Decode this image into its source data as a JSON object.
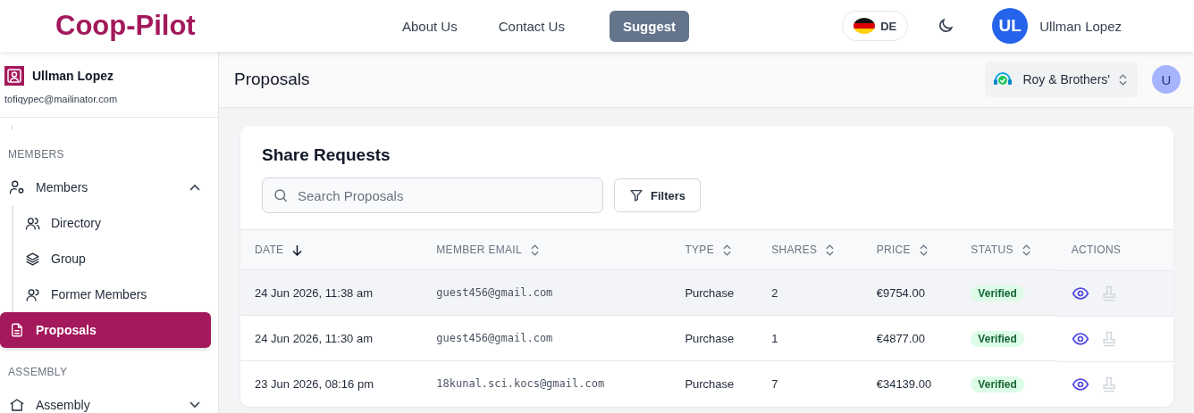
{
  "header": {
    "logo": "Coop-Pilot",
    "nav": [
      {
        "label": "About Us",
        "kind": "link"
      },
      {
        "label": "Contact Us",
        "kind": "link"
      },
      {
        "label": "Suggest",
        "kind": "button"
      }
    ],
    "language": "DE",
    "user": {
      "initials": "UL",
      "name": "Ullman Lopez"
    }
  },
  "sidebar": {
    "user": {
      "name": "Ullman Lopez",
      "email": "tofiqypec@mailinator.com"
    },
    "sections": [
      {
        "title": "MEMBERS",
        "items": [
          {
            "label": "Members",
            "selected": false,
            "expanded": true,
            "children": [
              {
                "label": "Directory",
                "selected": false
              },
              {
                "label": "Group",
                "selected": false
              },
              {
                "label": "Former Members",
                "selected": false
              }
            ]
          },
          {
            "label": "Proposals",
            "selected": true
          }
        ]
      },
      {
        "title": "ASSEMBLY",
        "items": [
          {
            "label": "Assembly",
            "selected": false,
            "expanded": false
          }
        ]
      }
    ]
  },
  "page": {
    "title": "Proposals",
    "organization": "Roy & Brothers'",
    "avatar": "U"
  },
  "card": {
    "title": "Share Requests",
    "search": {
      "placeholder": "Search Proposals"
    },
    "filters_button": "Filters",
    "table": {
      "columns": [
        {
          "label": "DATE",
          "kind": "sorted"
        },
        {
          "label": "MEMBER EMAIL",
          "kind": "sortable"
        },
        {
          "label": "TYPE",
          "kind": "sortable"
        },
        {
          "label": "SHARES",
          "kind": "sortable"
        },
        {
          "label": "PRICE",
          "kind": "sortable"
        },
        {
          "label": "STATUS",
          "kind": "sortable"
        },
        {
          "label": "ACTIONS",
          "kind": "plain"
        }
      ],
      "rows": [
        {
          "date": "24 Jun 2026, 11:38 am",
          "email": "guest456@gmail.com",
          "type": "Purchase",
          "shares": "2",
          "price": "€9754.00",
          "status": "Verified",
          "color": "#166534",
          "selected": true
        },
        {
          "date": "24 Jun 2026, 11:30 am",
          "email": "guest456@gmail.com",
          "type": "Purchase",
          "shares": "1",
          "price": "€4877.00",
          "status": "Verified",
          "color": "#166534",
          "selected": false
        },
        {
          "date": "23 Jun 2026, 08:16 pm",
          "email": "18kunal.sci.kocs@gmail.com",
          "type": "Purchase",
          "shares": "7",
          "price": "€34139.00",
          "status": "Verified",
          "color": "#166534",
          "selected": false
        }
      ]
    }
  }
}
